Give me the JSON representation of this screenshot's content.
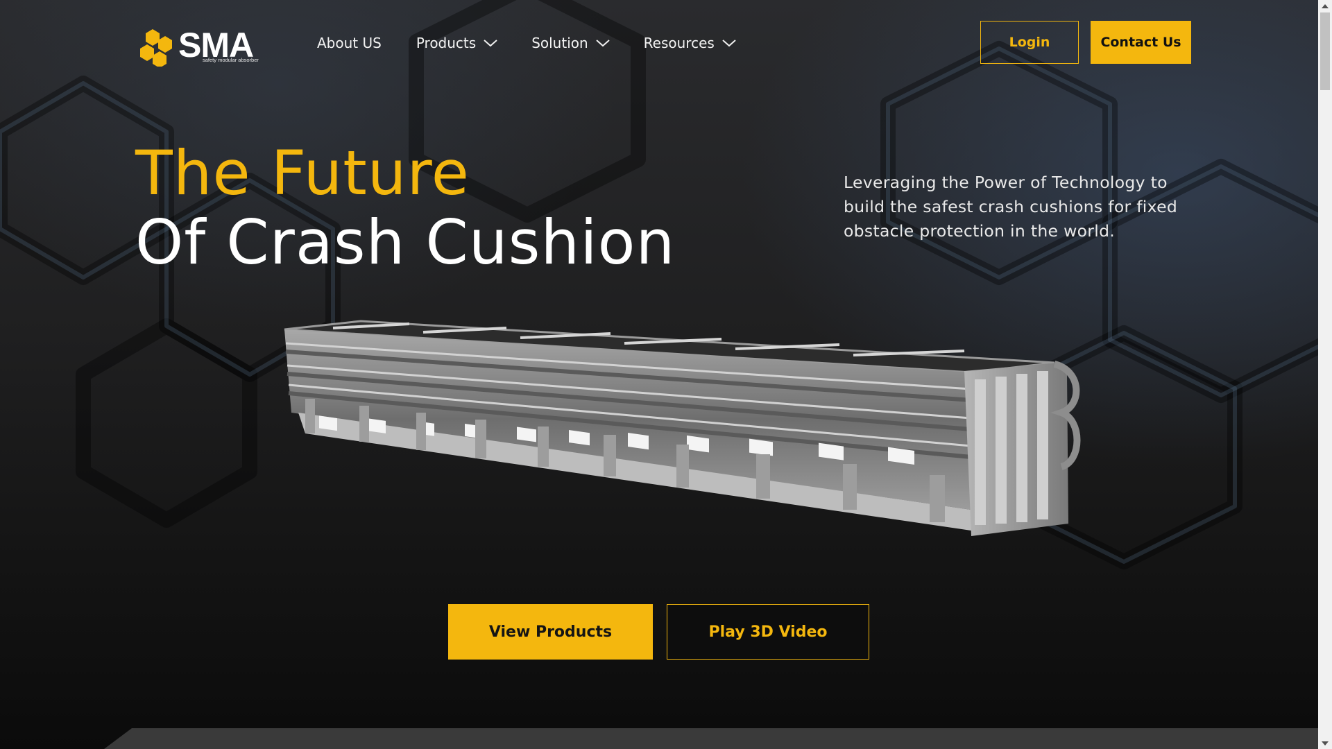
{
  "brand": {
    "name": "SMA",
    "tagline": "safety modular absorber",
    "accent_color": "#f4b70e"
  },
  "nav": {
    "items": [
      {
        "label": "About US",
        "has_dropdown": false
      },
      {
        "label": "Products",
        "has_dropdown": true
      },
      {
        "label": "Solution",
        "has_dropdown": true
      },
      {
        "label": "Resources",
        "has_dropdown": true
      }
    ],
    "login_label": "Login",
    "contact_label": "Contact Us"
  },
  "hero": {
    "title_line1": "The Future",
    "title_line2": "Of Crash Cushion",
    "description": "Leveraging the Power of Technology to build the safest crash cushions for fixed obstacle protection in the world.",
    "primary_cta": "View Products",
    "secondary_cta": "Play 3D Video",
    "product_image": "crash-cushion-3d-render"
  },
  "icons": {
    "dropdown": "chevron-down-icon",
    "logo": "honeycomb-logo-icon"
  }
}
